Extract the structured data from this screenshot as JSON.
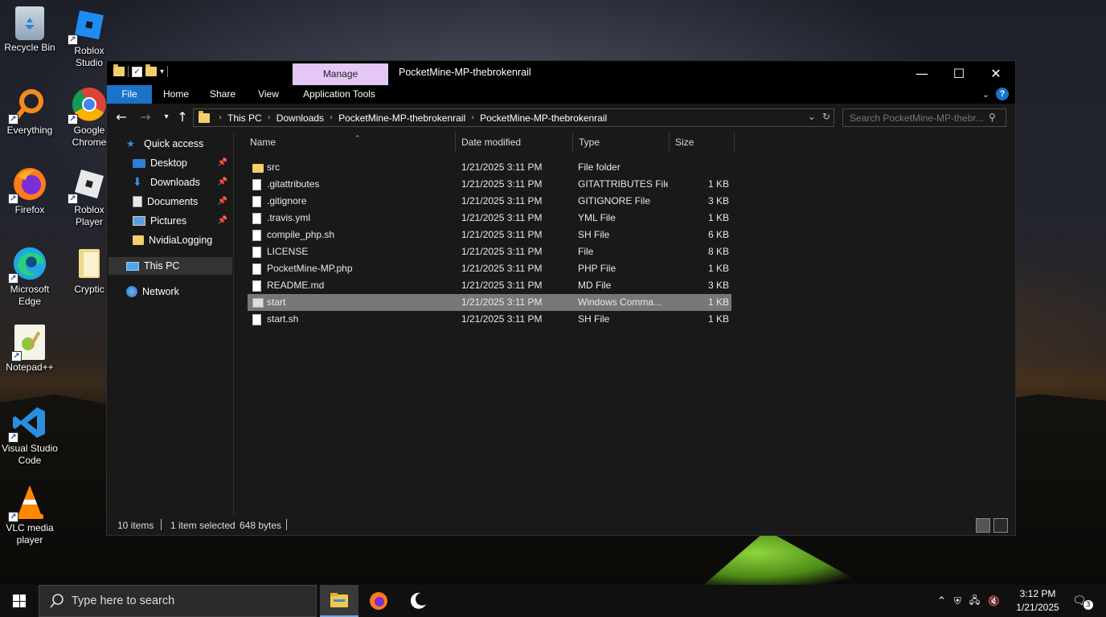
{
  "desktop": {
    "icons": [
      {
        "label": "Recycle Bin"
      },
      {
        "label": "Roblox Studio"
      },
      {
        "label": "Everything"
      },
      {
        "label": "Google Chrome"
      },
      {
        "label": "Firefox"
      },
      {
        "label": "Roblox Player"
      },
      {
        "label": "Microsoft Edge"
      },
      {
        "label": "Cryptic"
      },
      {
        "label": "Notepad++"
      },
      {
        "label": "Visual Studio Code"
      },
      {
        "label": "VLC media player"
      }
    ]
  },
  "window": {
    "title": "PocketMine-MP-thebrokenrail",
    "context_tab": "Manage",
    "controls": {
      "minimize": "—",
      "maximize": "☐",
      "close": "✕"
    },
    "ribbon_tabs": [
      "File",
      "Home",
      "Share",
      "View",
      "Application Tools"
    ],
    "address": {
      "crumbs": [
        "This PC",
        "Downloads",
        "PocketMine-MP-thebrokenrail",
        "PocketMine-MP-thebrokenrail"
      ]
    },
    "search_placeholder": "Search PocketMine-MP-thebr...",
    "nav": {
      "quick_access": "Quick access",
      "items": [
        "Desktop",
        "Downloads",
        "Documents",
        "Pictures",
        "NvidiaLogging"
      ],
      "this_pc": "This PC",
      "network": "Network"
    },
    "columns": [
      "Name",
      "Date modified",
      "Type",
      "Size"
    ],
    "files": [
      {
        "name": "src",
        "date": "1/21/2025 3:11 PM",
        "type": "File folder",
        "size": "",
        "kind": "folder"
      },
      {
        "name": ".gitattributes",
        "date": "1/21/2025 3:11 PM",
        "type": "GITATTRIBUTES File",
        "size": "1 KB",
        "kind": "file"
      },
      {
        "name": ".gitignore",
        "date": "1/21/2025 3:11 PM",
        "type": "GITIGNORE File",
        "size": "3 KB",
        "kind": "file"
      },
      {
        "name": ".travis.yml",
        "date": "1/21/2025 3:11 PM",
        "type": "YML File",
        "size": "1 KB",
        "kind": "file"
      },
      {
        "name": "compile_php.sh",
        "date": "1/21/2025 3:11 PM",
        "type": "SH File",
        "size": "6 KB",
        "kind": "file"
      },
      {
        "name": "LICENSE",
        "date": "1/21/2025 3:11 PM",
        "type": "File",
        "size": "8 KB",
        "kind": "file"
      },
      {
        "name": "PocketMine-MP.php",
        "date": "1/21/2025 3:11 PM",
        "type": "PHP File",
        "size": "1 KB",
        "kind": "file"
      },
      {
        "name": "README.md",
        "date": "1/21/2025 3:11 PM",
        "type": "MD File",
        "size": "3 KB",
        "kind": "file"
      },
      {
        "name": "start",
        "date": "1/21/2025 3:11 PM",
        "type": "Windows Comma...",
        "size": "1 KB",
        "kind": "cmd",
        "selected": true
      },
      {
        "name": "start.sh",
        "date": "1/21/2025 3:11 PM",
        "type": "SH File",
        "size": "1 KB",
        "kind": "file"
      }
    ],
    "status": {
      "count": "10 items",
      "selection": "1 item selected",
      "size": "648 bytes"
    }
  },
  "taskbar": {
    "search_placeholder": "Type here to search",
    "time": "3:12 PM",
    "date": "1/21/2025",
    "notification_count": "3"
  },
  "colors": {
    "accent": "#1a73c8",
    "manage_tab": "#e4c7f5",
    "window_bg": "#191919",
    "selected_row": "#777777"
  }
}
